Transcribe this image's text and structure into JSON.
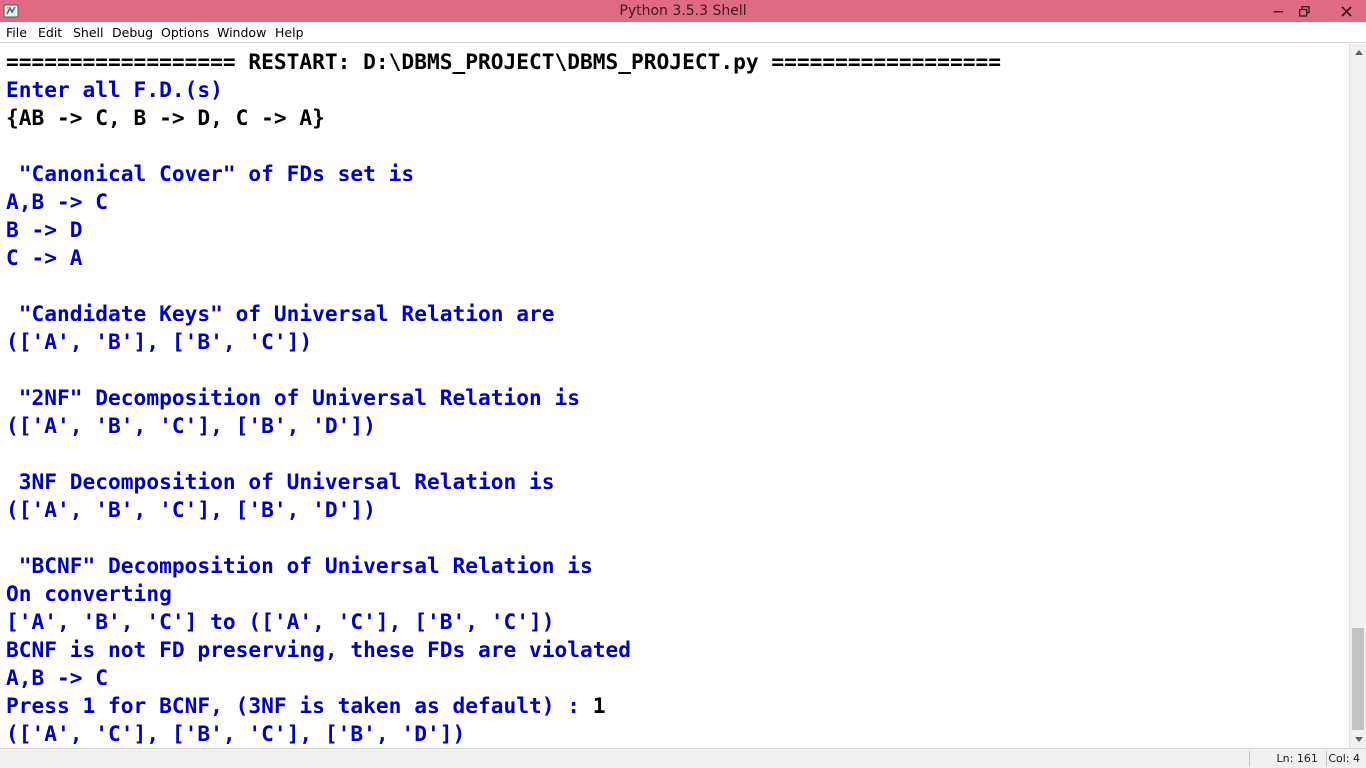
{
  "window": {
    "title": "Python 3.5.3 Shell",
    "titlebar_color": "#e06a82"
  },
  "icons": {
    "app": "python-idle-icon",
    "minimize": "minimize-icon",
    "restore": "restore-icon",
    "close": "close-icon"
  },
  "menu": [
    {
      "label": "File"
    },
    {
      "label": "Edit"
    },
    {
      "label": "Shell"
    },
    {
      "label": "Debug"
    },
    {
      "label": "Options"
    },
    {
      "label": "Window"
    },
    {
      "label": "Help"
    }
  ],
  "colors": {
    "output": "#0000c0",
    "input": "#000000"
  },
  "shell_lines": [
    {
      "text": "================== RESTART: D:\\DBMS_PROJECT\\DBMS_PROJECT.py ==================",
      "kind": "input"
    },
    {
      "text": "Enter all F.D.(s)",
      "kind": "output"
    },
    {
      "text": "{AB -> C, B -> D, C -> A}",
      "kind": "input"
    },
    {
      "text": "",
      "kind": "output"
    },
    {
      "text": " \"Canonical Cover\" of FDs set is",
      "kind": "output"
    },
    {
      "text": "A,B -> C",
      "kind": "output"
    },
    {
      "text": "B -> D",
      "kind": "output"
    },
    {
      "text": "C -> A",
      "kind": "output"
    },
    {
      "text": "",
      "kind": "output"
    },
    {
      "text": " \"Candidate Keys\" of Universal Relation are",
      "kind": "output"
    },
    {
      "text": "(['A', 'B'], ['B', 'C'])",
      "kind": "output"
    },
    {
      "text": "",
      "kind": "output"
    },
    {
      "text": " \"2NF\" Decomposition of Universal Relation is",
      "kind": "output"
    },
    {
      "text": "(['A', 'B', 'C'], ['B', 'D'])",
      "kind": "output"
    },
    {
      "text": "",
      "kind": "output"
    },
    {
      "text": " 3NF Decomposition of Universal Relation is",
      "kind": "output"
    },
    {
      "text": "(['A', 'B', 'C'], ['B', 'D'])",
      "kind": "output"
    },
    {
      "text": "",
      "kind": "output"
    },
    {
      "text": " \"BCNF\" Decomposition of Universal Relation is",
      "kind": "output"
    },
    {
      "text": "On converting",
      "kind": "output"
    },
    {
      "text": "['A', 'B', 'C'] to (['A', 'C'], ['B', 'C'])",
      "kind": "output"
    },
    {
      "text": "BCNF is not FD preserving, these FDs are violated",
      "kind": "output"
    },
    {
      "text": "A,B -> C",
      "kind": "output"
    },
    {
      "text": "Press 1 for BCNF, (3NF is taken as default) : ",
      "kind": "output",
      "input": "1"
    },
    {
      "text": "(['A', 'C'], ['B', 'C'], ['B', 'D'])",
      "kind": "output"
    }
  ],
  "status": {
    "position": "Ln: 161   Col: 4"
  }
}
